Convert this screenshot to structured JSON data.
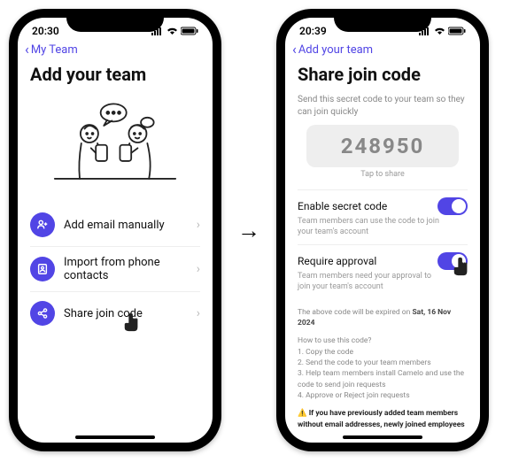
{
  "phone1": {
    "status_time": "20:30",
    "back_label": "My Team",
    "title": "Add your team",
    "options": {
      "add_email": "Add email manually",
      "import_contacts": "Import from phone contacts",
      "share_code": "Share join code"
    }
  },
  "arrow_glyph": "→",
  "phone2": {
    "status_time": "20:39",
    "back_label": "Add your team",
    "title": "Share join code",
    "subtitle": "Send this secret code to your team so they can join quickly",
    "code": "248950",
    "tap_hint": "Tap to share",
    "settings": {
      "enable": {
        "title": "Enable secret code",
        "desc": "Team members can use the code to join your team's account"
      },
      "approval": {
        "title": "Require approval",
        "desc": "Team members need your approval to join your team's account"
      }
    },
    "expiry_prefix": "The above code will be expired on ",
    "expiry_date": "Sat, 16 Nov 2024",
    "howto_title": "How to use this code?",
    "howto_1": "1. Copy the code",
    "howto_2": "2. Send the code to your team members",
    "howto_3": "3. Help team members install Camelo and use the code to send join requests",
    "howto_4": "4. Approve or Reject join requests",
    "warning": "⚠️ If you have previously added team members without email addresses, newly joined employees can choose these existing team members to complete their account setup."
  }
}
